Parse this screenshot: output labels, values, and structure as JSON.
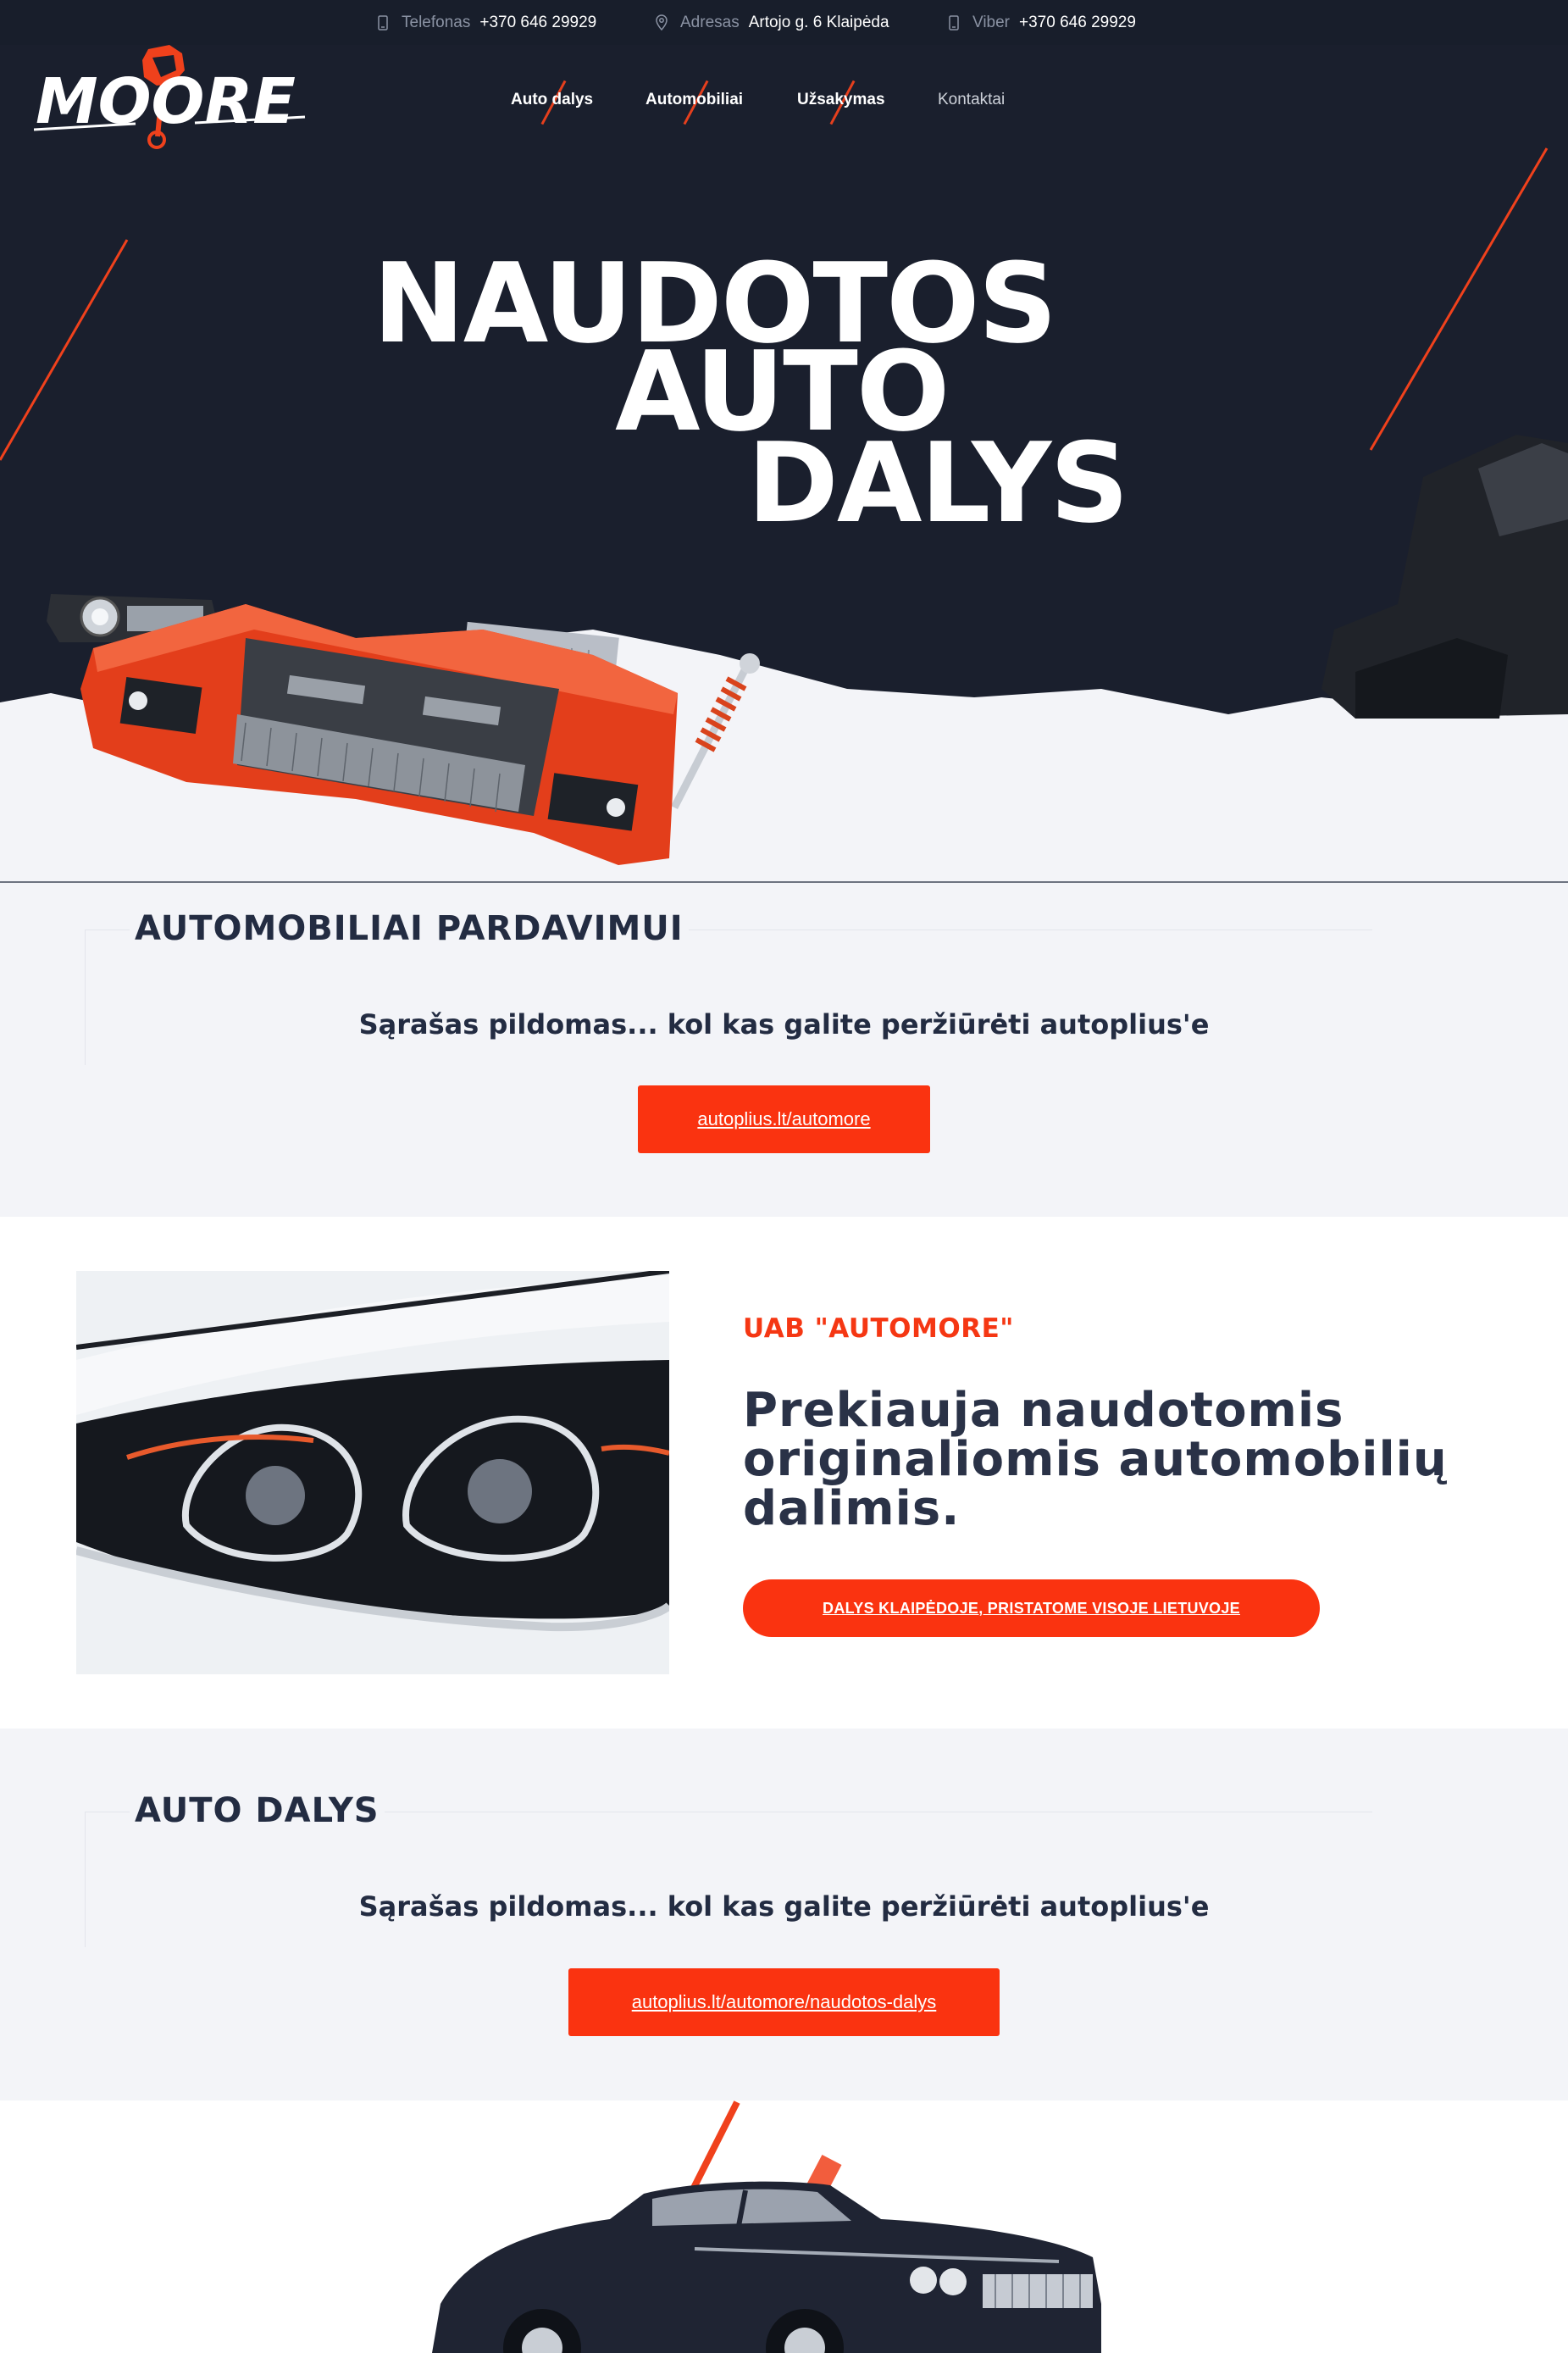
{
  "topbar": {
    "phone_label": "Telefonas",
    "phone_value": "+370 646 29929",
    "address_label": "Adresas",
    "address_value": "Artojo g. 6 Klaipėda",
    "viber_label": "Viber",
    "viber_value": "+370 646 29929"
  },
  "brand": {
    "logo_text": "MOORE",
    "accent": "#fa3310",
    "dark": "#1a1f2d"
  },
  "nav": {
    "items": [
      "Auto dalys",
      "Automobiliai",
      "Užsakymas",
      "Kontaktai"
    ]
  },
  "hero": {
    "line1": "NAUDOTOS",
    "line2": "AUTO",
    "line3": "DALYS"
  },
  "cars_section": {
    "title": "AUTOMOBILIAI PARDAVIMUI",
    "subtitle": "Sąrašas pildomas... kol kas galite peržiūrėti autoplius'e",
    "button": "autoplius.lt/automore"
  },
  "about": {
    "eyebrow": "UAB \"AUTOMORE\"",
    "headline": "Prekiauja naudotomis originaliomis automobilių dalimis.",
    "button": "DALYS KLAIPĖDOJE, PRISTATOME VISOJE LIETUVOJE"
  },
  "parts_section": {
    "title": "AUTO DALYS",
    "subtitle": "Sąrašas pildomas... kol kas galite peržiūrėti autoplius'e",
    "button": "autoplius.lt/automore/naudotos-dalys"
  }
}
